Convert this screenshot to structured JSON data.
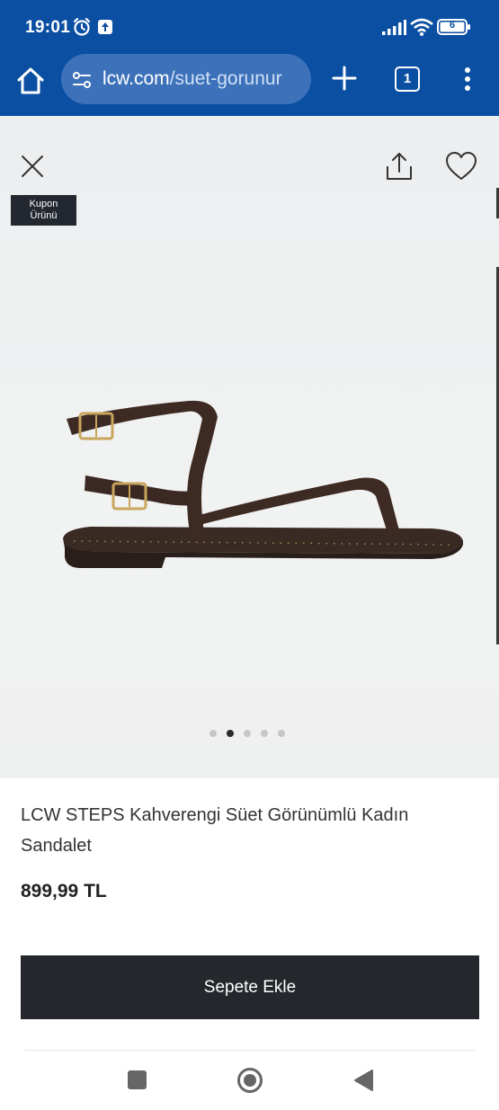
{
  "status_bar": {
    "time": "19:01",
    "battery": "6",
    "icons": [
      "alarm-icon",
      "notification-icon",
      "signal-icon",
      "wifi-icon",
      "battery-icon"
    ]
  },
  "browser": {
    "url_domain": "lcw.com",
    "url_path": "/suet-gorunur",
    "tab_count": "1",
    "colors": {
      "bar": "#0b4fa3",
      "url_pill": "#3d72bb"
    }
  },
  "gallery": {
    "badge_line1": "Kupon",
    "badge_line2": "Ürünü",
    "dots_total": 5,
    "active_dot_index": 1
  },
  "product": {
    "title": "LCW STEPS Kahverengi Süet Görünümlü Kadın Sandalet",
    "price": "899,99 TL",
    "add_to_cart_label": "Sepete Ekle"
  }
}
